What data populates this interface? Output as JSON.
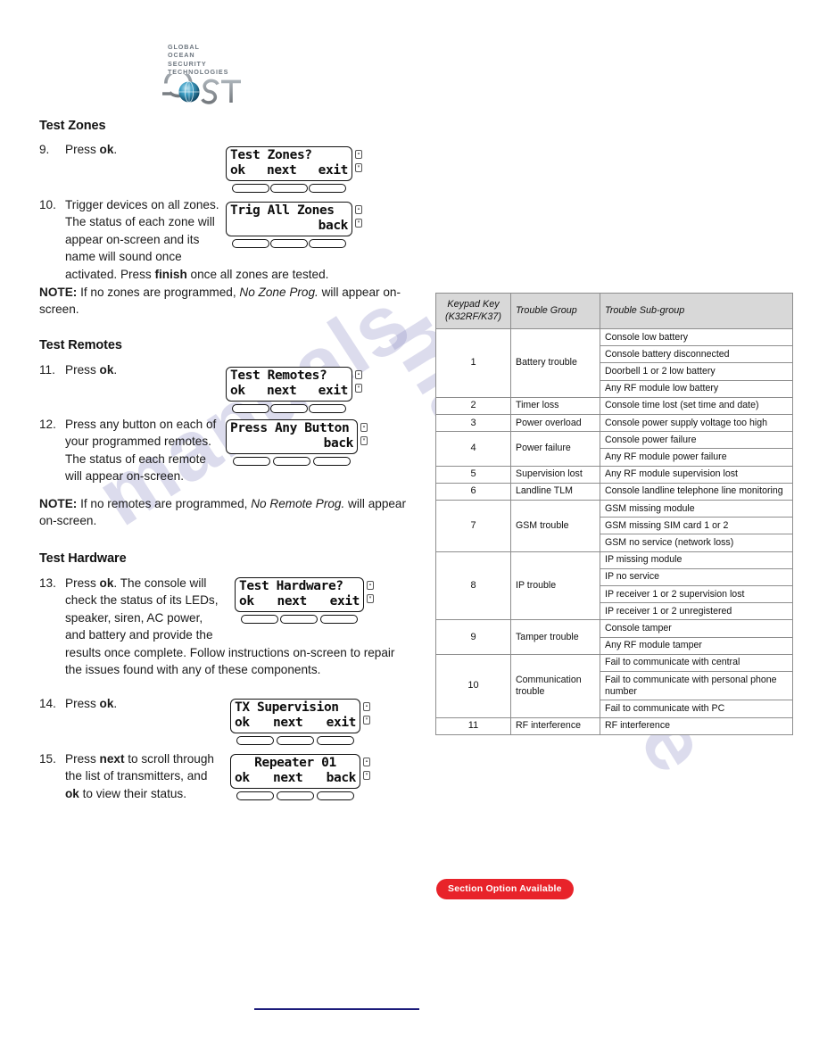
{
  "logo": {
    "name": "GOST",
    "tagline_lines": [
      "GLOBAL",
      "OCEAN",
      "SECURITY",
      "TECHNOLOGIES"
    ],
    "letters_before": "G",
    "letters_after": "ST",
    "colors": {
      "letters": "#8a9299",
      "globe": "#1b6f9e"
    }
  },
  "watermark": {
    "text_a": "manualshive",
    "text_b": "manuals",
    "color": "#8f8ec4"
  },
  "sections": {
    "test_zones": {
      "heading": "Test Zones",
      "steps": [
        {
          "number": "9.",
          "text_html": "Press <b>ok</b>.",
          "lcd": {
            "line1": "Test Zones?",
            "line2_left": "ok",
            "line2_mid": "next",
            "line2_right": "exit",
            "layout": "three"
          }
        },
        {
          "number": "10.",
          "text_html": "Trigger devices on all zones. The status of each zone will appear on-screen and its name will sound once activated. Press <b>finish</b> once all zones are tested.",
          "lcd": {
            "line1": "Trig All Zones",
            "line2_right": "back",
            "layout": "right"
          }
        }
      ],
      "note_html": "<b>NOTE:</b> If no zones are programmed, <i>No Zone Prog.</i> will appear on-screen."
    },
    "test_remotes": {
      "heading": "Test Remotes",
      "steps": [
        {
          "number": "11.",
          "text_html": "Press <b>ok</b>.",
          "lcd": {
            "line1": "Test Remotes?",
            "line2_left": "ok",
            "line2_mid": "next",
            "line2_right": "exit",
            "layout": "three"
          }
        },
        {
          "number": "12.",
          "text_html": "Press any button on each of your programmed remotes. The status of each remote will appear on-screen.",
          "lcd": {
            "line1": "Press Any Button",
            "line2_right": "back",
            "layout": "right"
          }
        }
      ],
      "note_html": "<b>NOTE:</b> If no remotes are programmed, <i>No Remote Prog.</i> will appear on-screen."
    },
    "test_hardware": {
      "heading": "Test Hardware",
      "steps": [
        {
          "number": "13.",
          "text_html": "Press <b>ok</b>. The console will check the status of its LEDs, speaker, siren, AC power, and battery and provide the results once complete. Follow instructions on-screen to repair the issues found with any of these components.",
          "lcd": {
            "line1": "Test Hardware?",
            "line2_left": "ok",
            "line2_mid": "next",
            "line2_right": "exit",
            "layout": "three"
          }
        },
        {
          "number": "14.",
          "text_html": "Press <b>ok</b>.",
          "lcd": {
            "line1": "TX Supervision",
            "line2_left": "ok",
            "line2_mid": "next",
            "line2_right": "exit",
            "layout": "three"
          }
        },
        {
          "number": "15.",
          "text_html": "Press <b>next</b> to scroll through the list of transmitters, and <b>ok</b> to view their status.",
          "lcd": {
            "line1": "Repeater 01",
            "line2_left": "ok",
            "line2_mid": "next",
            "line2_right": "back",
            "layout": "three",
            "line1_align": "center"
          }
        }
      ]
    }
  },
  "trouble_table": {
    "headers": [
      "Keypad Key (K32RF/K37)",
      "Trouble Group",
      "Trouble Sub-group"
    ],
    "header_line1": "Keypad Key",
    "header_line2": "(K32RF/K37)",
    "rows": [
      {
        "key": "1",
        "group": "Battery trouble",
        "subgroups": [
          "Console low battery",
          "Console battery disconnected",
          "Doorbell 1 or 2 low battery",
          "Any RF module low battery"
        ]
      },
      {
        "key": "2",
        "group": "Timer loss",
        "subgroups": [
          "Console time lost (set time and date)"
        ]
      },
      {
        "key": "3",
        "group": "Power overload",
        "subgroups": [
          "Console power supply voltage too high"
        ]
      },
      {
        "key": "4",
        "group": "Power failure",
        "subgroups": [
          "Console power failure",
          "Any RF module power failure"
        ]
      },
      {
        "key": "5",
        "group": "Supervision lost",
        "subgroups": [
          "Any RF module supervision lost"
        ]
      },
      {
        "key": "6",
        "group": "Landline TLM",
        "subgroups": [
          "Console landline telephone line monitoring"
        ]
      },
      {
        "key": "7",
        "group": "GSM trouble",
        "subgroups": [
          "GSM missing module",
          "GSM missing SIM card 1 or 2",
          "GSM no service (network loss)"
        ]
      },
      {
        "key": "8",
        "group": "IP trouble",
        "subgroups": [
          "IP missing module",
          "IP no service",
          "IP receiver 1 or 2 supervision lost",
          "IP receiver 1 or 2 unregistered"
        ]
      },
      {
        "key": "9",
        "group": "Tamper trouble",
        "subgroups": [
          "Console tamper",
          "Any RF module tamper"
        ]
      },
      {
        "key": "10",
        "group": "Communication trouble",
        "subgroups": [
          "Fail to communicate with central",
          "Fail to communicate with personal phone number",
          "Fail to communicate with PC"
        ]
      },
      {
        "key": "11",
        "group": "RF interference",
        "subgroups": [
          "RF interference"
        ]
      }
    ]
  },
  "badge": {
    "label": "Section Option Available",
    "color": "#e8232a"
  }
}
